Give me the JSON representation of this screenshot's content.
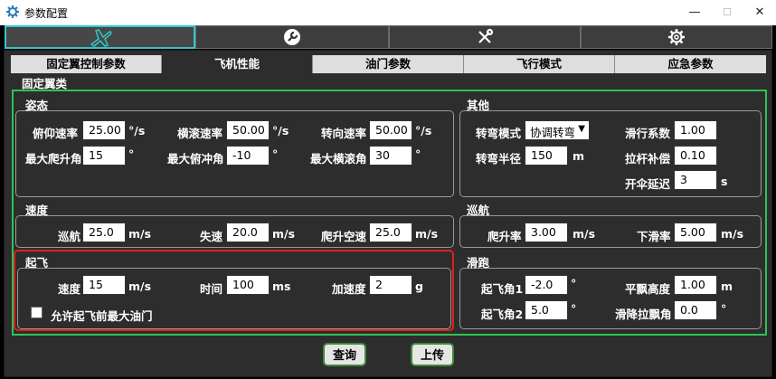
{
  "window": {
    "title": "参数配置",
    "minimize": "—",
    "maximize": "☐",
    "close": "✕"
  },
  "icon_tabs": [
    "airplane-icon",
    "wrench-circle-icon",
    "tools-icon",
    "gear-icon"
  ],
  "sub_tabs": [
    "固定翼控制参数",
    "飞机性能",
    "油门参数",
    "飞行模式",
    "应急参数"
  ],
  "active_sub_tab": "飞机性能",
  "section_title": "固定翼类",
  "attitude": {
    "title": "姿态",
    "pitch_rate": {
      "label": "俯仰速率",
      "value": "25.00",
      "unit": "°/s"
    },
    "roll_rate": {
      "label": "横滚速率",
      "value": "50.00",
      "unit": "°/s"
    },
    "yaw_rate": {
      "label": "转向速率",
      "value": "50.00",
      "unit": "°/s"
    },
    "max_climb": {
      "label": "最大爬升角",
      "value": "15",
      "unit": "°"
    },
    "max_dive": {
      "label": "最大俯冲角",
      "value": "-10",
      "unit": "°"
    },
    "max_bank": {
      "label": "最大横滚角",
      "value": "30",
      "unit": "°"
    }
  },
  "other": {
    "title": "其他",
    "turn_mode": {
      "label": "转弯模式",
      "value": "协调转弯"
    },
    "glide": {
      "label": "滑行系数",
      "value": "1.00"
    },
    "turn_radius": {
      "label": "转弯半径",
      "value": "150",
      "unit": "m"
    },
    "pull_comp": {
      "label": "拉杆补偿",
      "value": "0.10"
    },
    "chute_delay": {
      "label": "开伞延迟",
      "value": "3",
      "unit": "s"
    }
  },
  "speed": {
    "title": "速度",
    "cruise": {
      "label": "巡航",
      "value": "25.0",
      "unit": "m/s"
    },
    "stall": {
      "label": "失速",
      "value": "20.0",
      "unit": "m/s"
    },
    "climb_airspeed": {
      "label": "爬升空速",
      "value": "25.0",
      "unit": "m/s"
    }
  },
  "cruise": {
    "title": "巡航",
    "climb_rate": {
      "label": "爬升率",
      "value": "3.00",
      "unit": "m/s"
    },
    "sink_rate": {
      "label": "下滑率",
      "value": "5.00",
      "unit": "m/s"
    }
  },
  "takeoff": {
    "title": "起飞",
    "speed": {
      "label": "速度",
      "value": "15",
      "unit": "m/s"
    },
    "time": {
      "label": "时间",
      "value": "100",
      "unit": "ms"
    },
    "accel": {
      "label": "加速度",
      "value": "2",
      "unit": "g"
    },
    "max_throttle_label": "允许起飞前最大油门"
  },
  "roll": {
    "title": "滑跑",
    "angle1": {
      "label": "起飞角1",
      "value": "-2.0",
      "unit": "°"
    },
    "level_height": {
      "label": "平飘高度",
      "value": "1.00",
      "unit": "m"
    },
    "angle2": {
      "label": "起飞角2",
      "value": "5.0",
      "unit": "°"
    },
    "flare_angle": {
      "label": "滑降拉飘角",
      "value": "0.0",
      "unit": "°"
    }
  },
  "buttons": {
    "query": "查询",
    "upload": "上传"
  }
}
